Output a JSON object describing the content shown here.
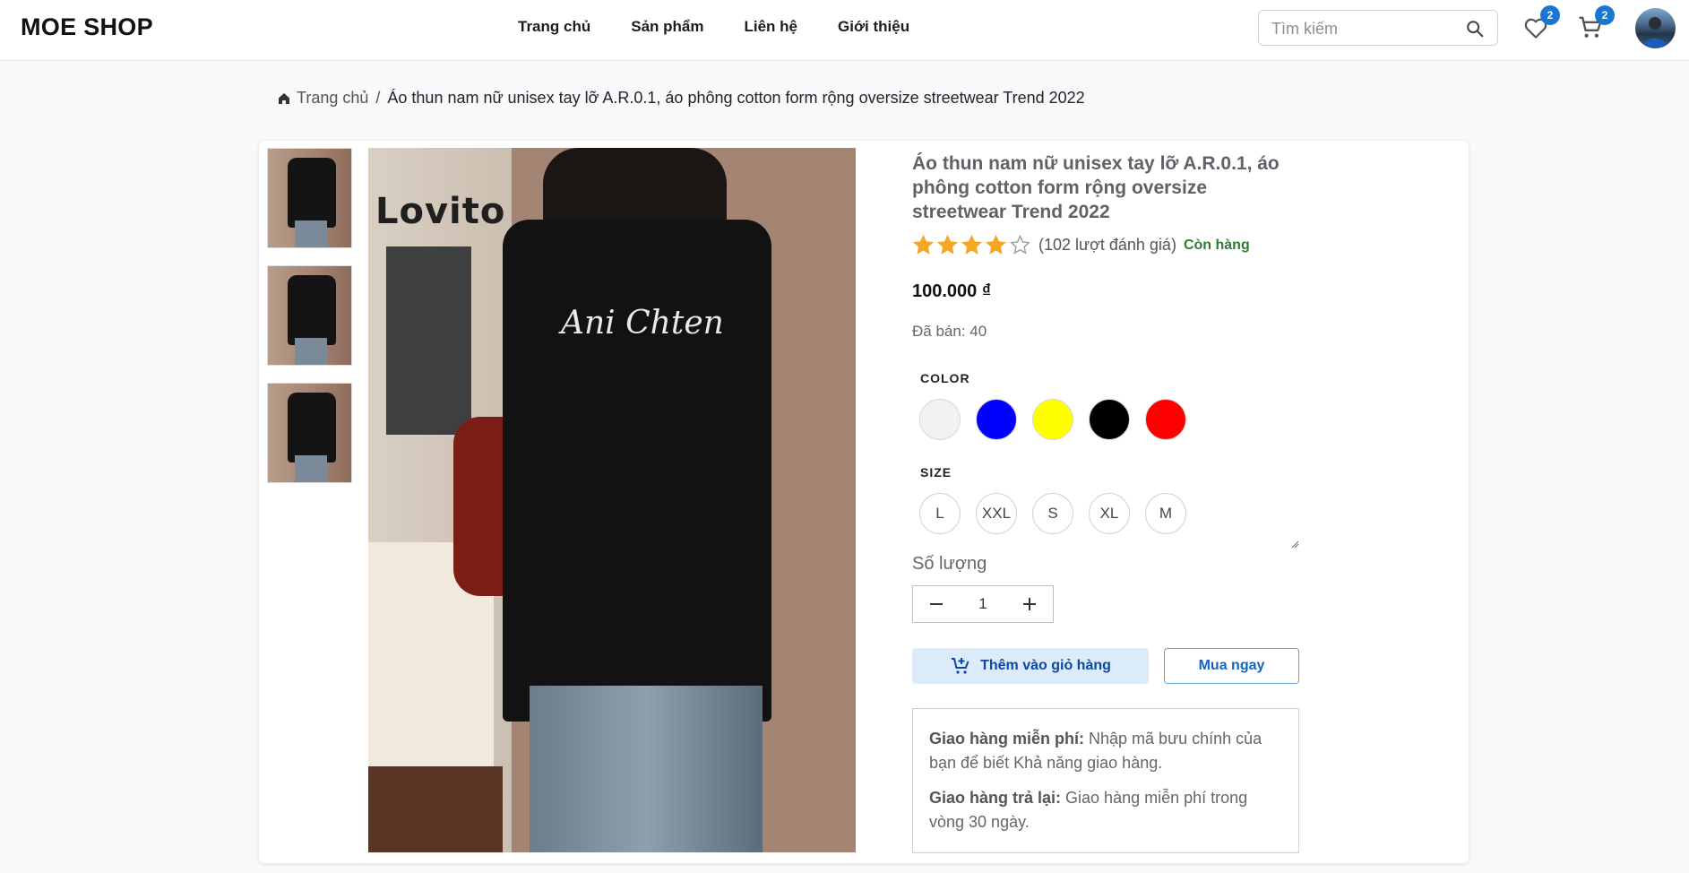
{
  "header": {
    "logo": "MOE SHOP",
    "nav": [
      "Trang chủ",
      "Sản phẩm",
      "Liên hệ",
      "Giới thiệu"
    ],
    "search_placeholder": "Tìm kiếm",
    "wishlist_count": "2",
    "cart_count": "2"
  },
  "breadcrumb": {
    "home": "Trang chủ",
    "separator": "/",
    "current": "Áo thun nam nữ unisex tay lỡ A.R.0.1, áo phông cotton form rộng oversize streetwear Trend 2022"
  },
  "product": {
    "image_brand_text": "Lovito",
    "image_print_text": "Ani Chten",
    "title": "Áo thun nam nữ unisex tay lỡ A.R.0.1, áo phông cotton form rộng oversize streetwear Trend 2022",
    "rating": 4,
    "rating_max": 5,
    "reviews": "(102 lượt đánh giá)",
    "stock": "Còn hàng",
    "price": "100.000 ₫",
    "sold": "Đã bán: 40",
    "color_label": "COLOR",
    "colors": [
      "#f2f2f2",
      "#0000ff",
      "#ffff00",
      "#000000",
      "#ff0000"
    ],
    "size_label": "SIZE",
    "sizes": [
      "L",
      "XXL",
      "S",
      "XL",
      "M"
    ],
    "quantity_label": "Số lượng",
    "quantity": "1",
    "add_to_cart": "Thêm vào giỏ hàng",
    "buy_now": "Mua ngay",
    "shipping": {
      "free_title": "Giao hàng miễn phí:",
      "free_text": " Nhập mã bưu chính của bạn để biết Khả năng giao hàng.",
      "return_title": "Giao hàng trả lại:",
      "return_text": " Giao hàng miễn phí trong vòng 30 ngày."
    }
  },
  "colors": {
    "accent": "#1976d2",
    "star": "#f5a623",
    "in_stock": "#2e7d32"
  }
}
